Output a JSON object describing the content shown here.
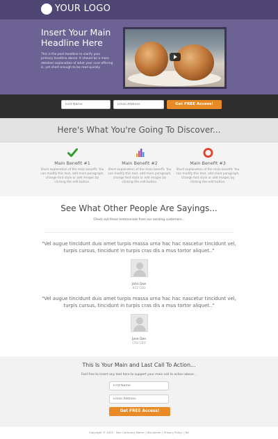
{
  "header": {
    "logo_text": "YOUR LOGO"
  },
  "hero": {
    "title": "Insert Your Main Headline Here",
    "subtitle": "This is the post headline to clarify your primary headline above. It should be a more detailed explanation of what your core offering is, yet short enough to be read quickly.",
    "video_icon": "play-icon"
  },
  "optin": {
    "first_name_placeholder": "First Name",
    "email_placeholder": "Email Address",
    "cta_label": "Get FREE Access!"
  },
  "discover": {
    "title": "Here's What You're Going To Discover..."
  },
  "benefits": [
    {
      "icon": "checkmark-icon",
      "title": "Main Benefit #1",
      "description": "Short explanation of the main benefit. You can modify this text, add more paragraph, change font style or add images by clicking the edit button."
    },
    {
      "icon": "bar-chart-icon",
      "title": "Main Benefit #2",
      "description": "Short explanation of the main benefit. You can modify this text, add more paragraph, change font style or add images by clicking the edit button."
    },
    {
      "icon": "lifebuoy-icon",
      "title": "Main Benefit #3",
      "description": "Short explanation of the main benefit. You can modify this text, add more paragraph, change font style or add images by clicking the edit button."
    }
  ],
  "testimonials": {
    "title": "See What Other People Are Sayings...",
    "subtitle": "Check out these testimonials from our existing customers...",
    "items": [
      {
        "quote": "\"Vel augue tincidunt duis amet turpis massa urna hac hac nascetur tincidunt vel, turpis cursus, tincidunt in turpis cras dis a mus tortor aliquet..\"",
        "name": "John Doe",
        "role": "XYZ CEO"
      },
      {
        "quote": "\"Vel augue tincidunt duis amet turpis massa urna hac hac nascetur tincidunt vel, turpis cursus, tincidunt in turpis cras dis a mus tortor aliquet..\"",
        "name": "Jane Doe",
        "role": "CFG CEO"
      }
    ]
  },
  "final_cta": {
    "title": "This Is Your Main and Last Call To Action...",
    "subtitle": "Feel free to insert any text here to support your main call to action above...",
    "first_name_placeholder": "First Name",
    "email_placeholder": "Email Address",
    "cta_label": "Get FREE Access!"
  },
  "footer": {
    "copyright": "Copyright © 2015 . Your Company Name",
    "links": [
      "Disclaimer",
      "Privacy Policy",
      "Toc"
    ]
  },
  "colors": {
    "header_bg": "#4f4674",
    "hero_bg": "#6c6394",
    "optin_bg": "#2e2e2e",
    "cta": "#e88a25",
    "check_green": "#2e9c2a",
    "lifebuoy_red": "#e0452f"
  }
}
